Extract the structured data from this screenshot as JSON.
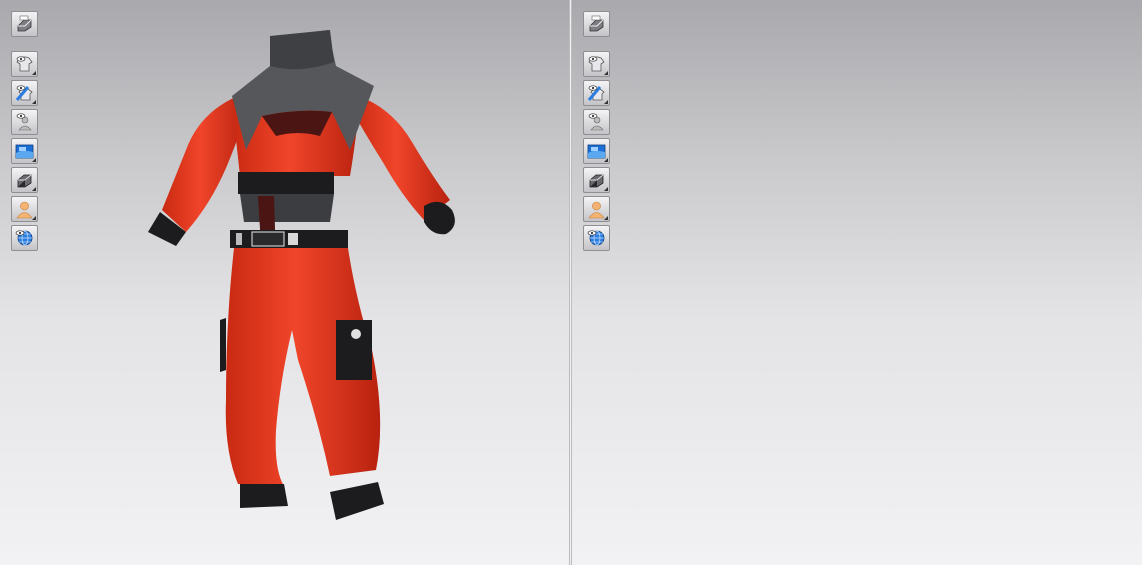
{
  "viewports": [
    {
      "id": "left",
      "view": "front",
      "toolbar": [
        "render-mode-icon",
        "show-garment-icon",
        "show-texture-icon",
        "show-avatar-icon",
        "show-fabric-icon",
        "show-solid-icon",
        "avatar-skin-icon",
        "show-mesh-icon"
      ]
    },
    {
      "id": "right",
      "view": "back",
      "toolbar": [
        "render-mode-icon",
        "show-garment-icon",
        "show-texture-icon",
        "show-avatar-icon",
        "show-fabric-icon",
        "show-solid-icon",
        "avatar-skin-icon",
        "show-mesh-icon"
      ]
    }
  ],
  "colors": {
    "fabric_red": "#e8391f",
    "fabric_red_shadow": "#b8220f",
    "leather_gray": "#55575a",
    "band_black": "#1c1c1e",
    "mesh_dark": "#4a1512",
    "background_top": "#a9a9ad",
    "background_bottom": "#f2f2f4"
  }
}
